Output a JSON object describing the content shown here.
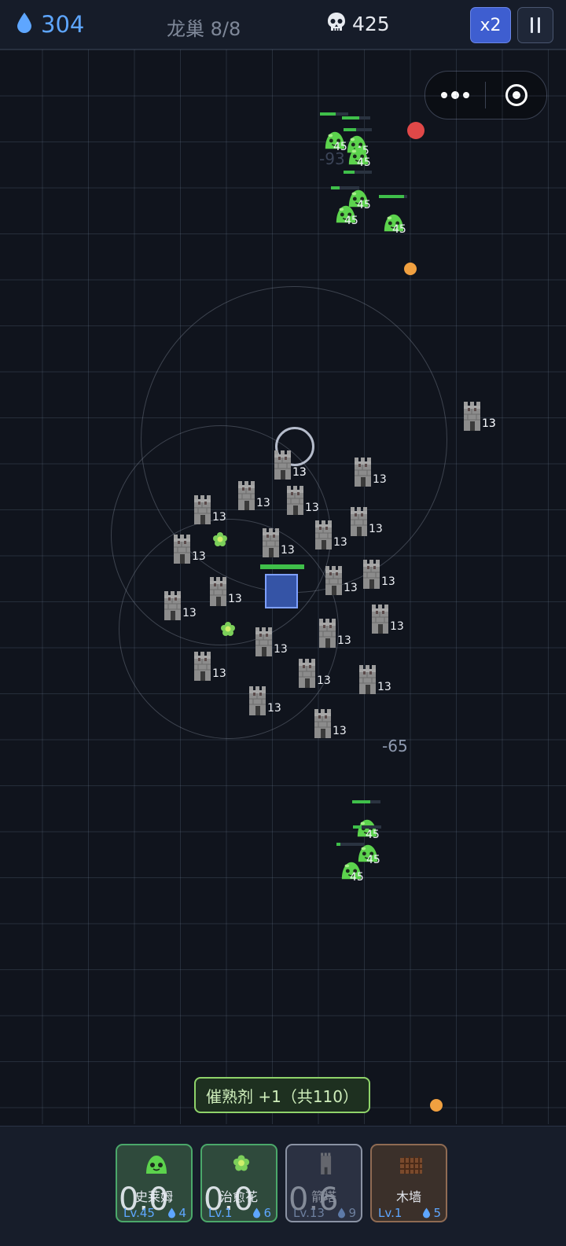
{
  "hud": {
    "water": "304",
    "wave": "龙巢 8/8",
    "kills": "425",
    "speed_label": "x2"
  },
  "towers": [
    {
      "id": "t1",
      "level": "13"
    },
    {
      "id": "t2",
      "level": "13"
    },
    {
      "id": "t3",
      "level": "13"
    },
    {
      "id": "t4",
      "level": "13"
    },
    {
      "id": "t5",
      "level": "13"
    },
    {
      "id": "t6",
      "level": "13"
    },
    {
      "id": "t7",
      "level": "13"
    },
    {
      "id": "t8",
      "level": "13"
    },
    {
      "id": "t9",
      "level": "13"
    },
    {
      "id": "t10",
      "level": "13"
    },
    {
      "id": "t11",
      "level": "13"
    },
    {
      "id": "t12",
      "level": "13"
    },
    {
      "id": "t13",
      "level": "13"
    },
    {
      "id": "t14",
      "level": "13"
    },
    {
      "id": "t15",
      "level": "13"
    },
    {
      "id": "t16",
      "level": "13"
    },
    {
      "id": "t17",
      "level": "13"
    },
    {
      "id": "t18",
      "level": "13"
    },
    {
      "id": "t19",
      "level": "13"
    },
    {
      "id": "t20",
      "level": "13"
    },
    {
      "id": "t21",
      "level": "13"
    },
    {
      "id": "t22",
      "level": "13"
    },
    {
      "id": "t23",
      "level": "13"
    },
    {
      "id": "t24",
      "level": "13"
    }
  ],
  "slimes": [
    {
      "id": "s1",
      "level": "45",
      "hp": 0.55
    },
    {
      "id": "s2",
      "level": "45",
      "hp": 0.6
    },
    {
      "id": "s3",
      "level": "45",
      "hp": 0.45
    },
    {
      "id": "s4",
      "level": "45",
      "hp": 0.4
    },
    {
      "id": "s5",
      "level": "45",
      "hp": 0.3
    },
    {
      "id": "s6",
      "level": "45",
      "hp": 0.9
    },
    {
      "id": "s7",
      "level": "45",
      "hp": 0.65
    },
    {
      "id": "s8",
      "level": "45",
      "hp": 0.3
    },
    {
      "id": "s9",
      "level": "45",
      "hp": 0.15
    }
  ],
  "core": {
    "hp": 1.0
  },
  "damage_numbers": [
    "-93",
    "-65"
  ],
  "toast": "催熟剂 +1（共110）",
  "cards": [
    {
      "name": "史莱姆",
      "cooldown": "0.0",
      "level": "Lv.45",
      "cost": "4",
      "icon": "slime-icon"
    },
    {
      "name": "治愈花",
      "cooldown": "0.0",
      "level": "Lv.1",
      "cost": "6",
      "icon": "flower-icon"
    },
    {
      "name": "箭塔",
      "cooldown": "0.6",
      "level": "Lv.13",
      "cost": "9",
      "icon": "tower-icon"
    },
    {
      "name": "木墙",
      "cooldown": "",
      "level": "Lv.1",
      "cost": "5",
      "icon": "wall-icon"
    }
  ],
  "colors": {
    "accent": "#5ea6ff",
    "green": "#3fbf4a",
    "toast_border": "#8fd36a",
    "enemy_dot": "#e04848",
    "orb": "#f0a040"
  }
}
